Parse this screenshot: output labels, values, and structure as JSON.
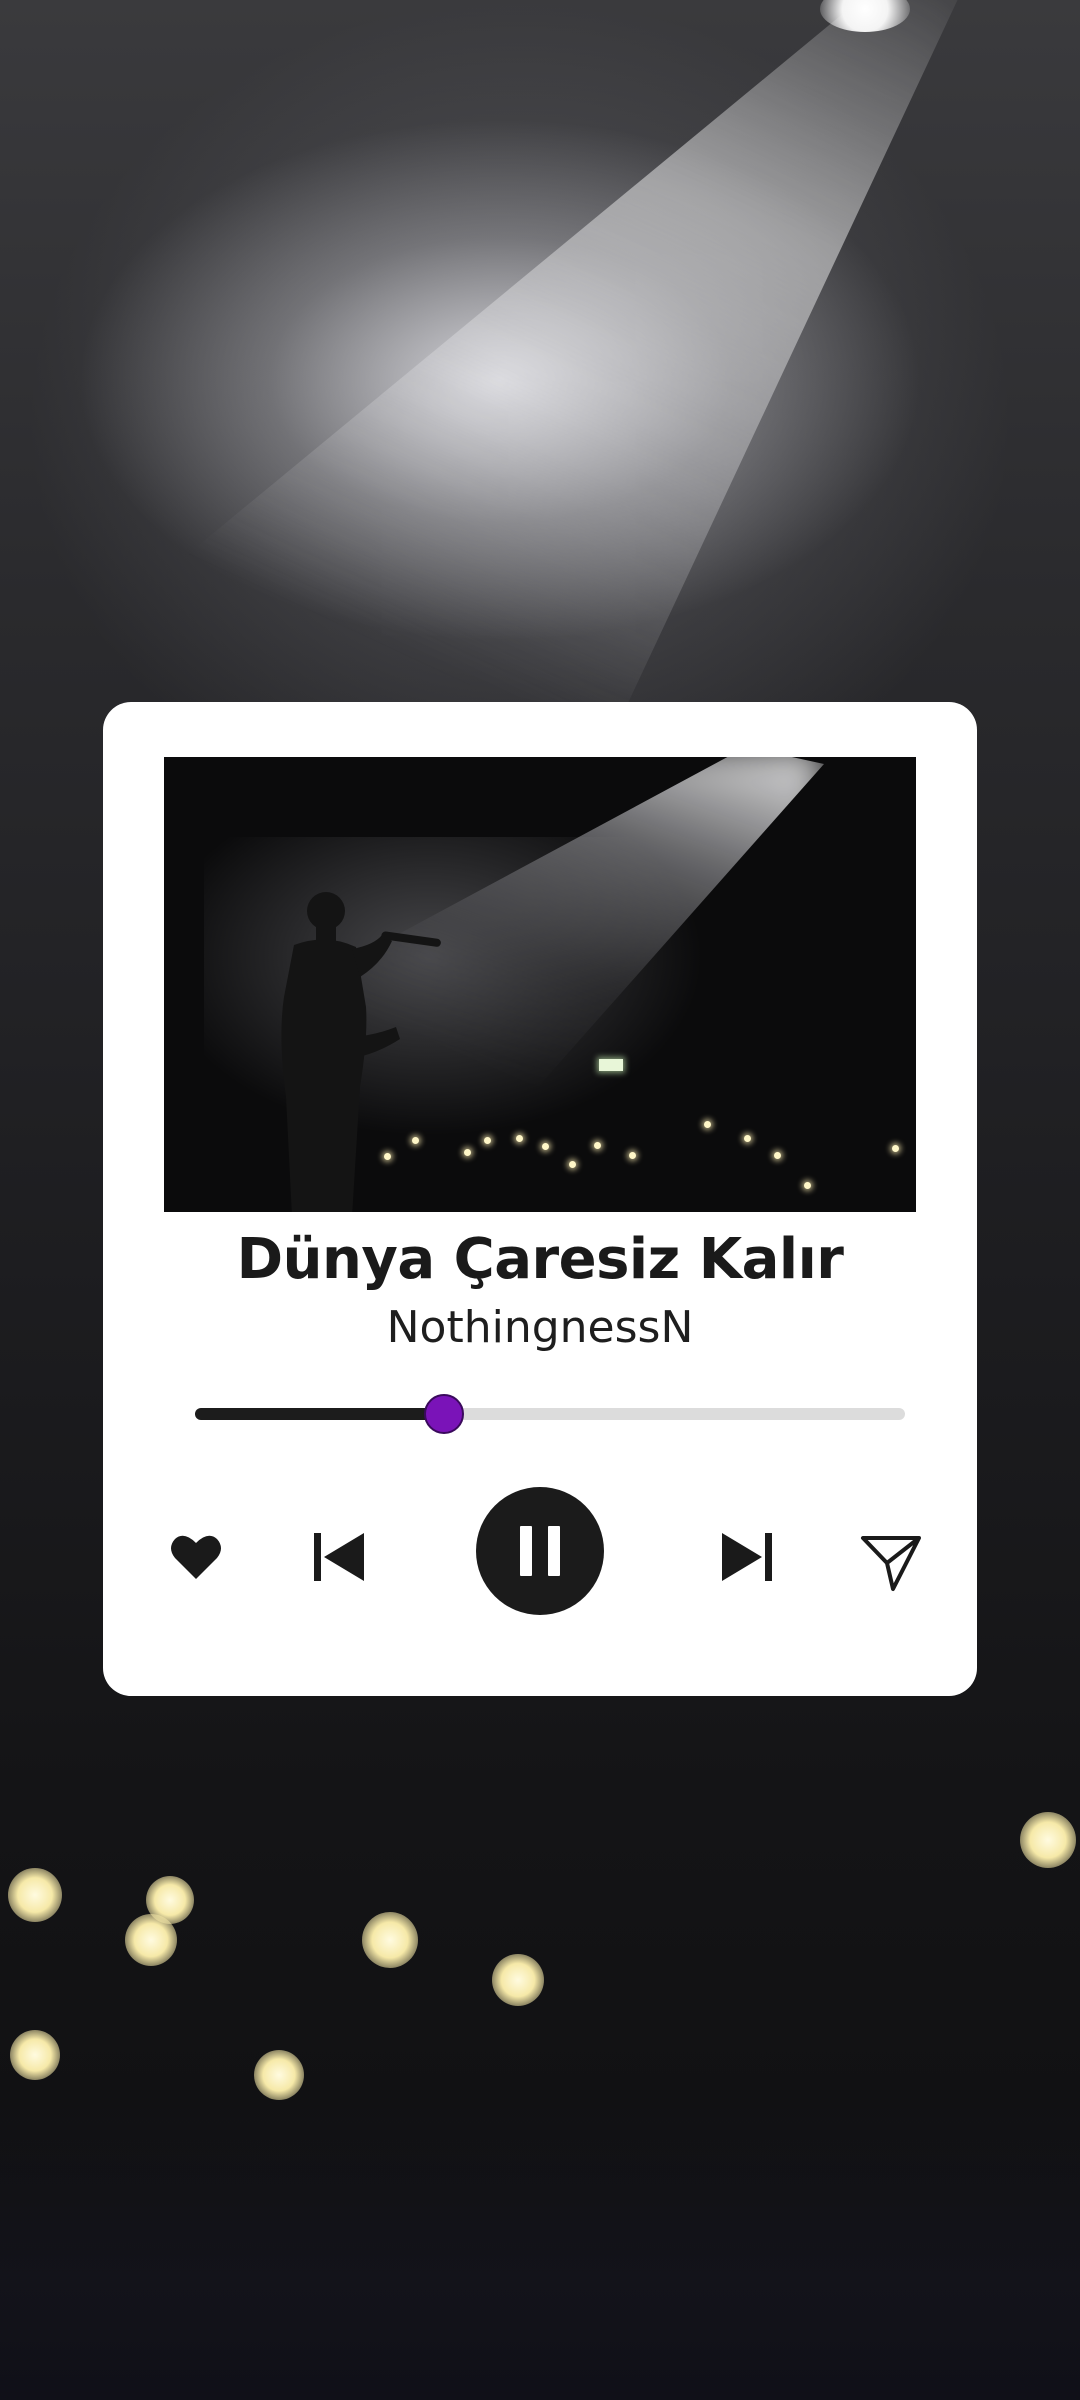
{
  "song": {
    "title": "Dünya Çaresiz Kalır",
    "artist": "NothingnessN"
  },
  "player": {
    "progress_fraction": 0.35,
    "state": "playing",
    "accent_color": "#7a13b8"
  },
  "controls": {
    "like_icon": "heart-icon",
    "previous_icon": "skip-previous-icon",
    "play_pause_icon": "pause-icon",
    "next_icon": "skip-next-icon",
    "share_icon": "send-icon"
  }
}
